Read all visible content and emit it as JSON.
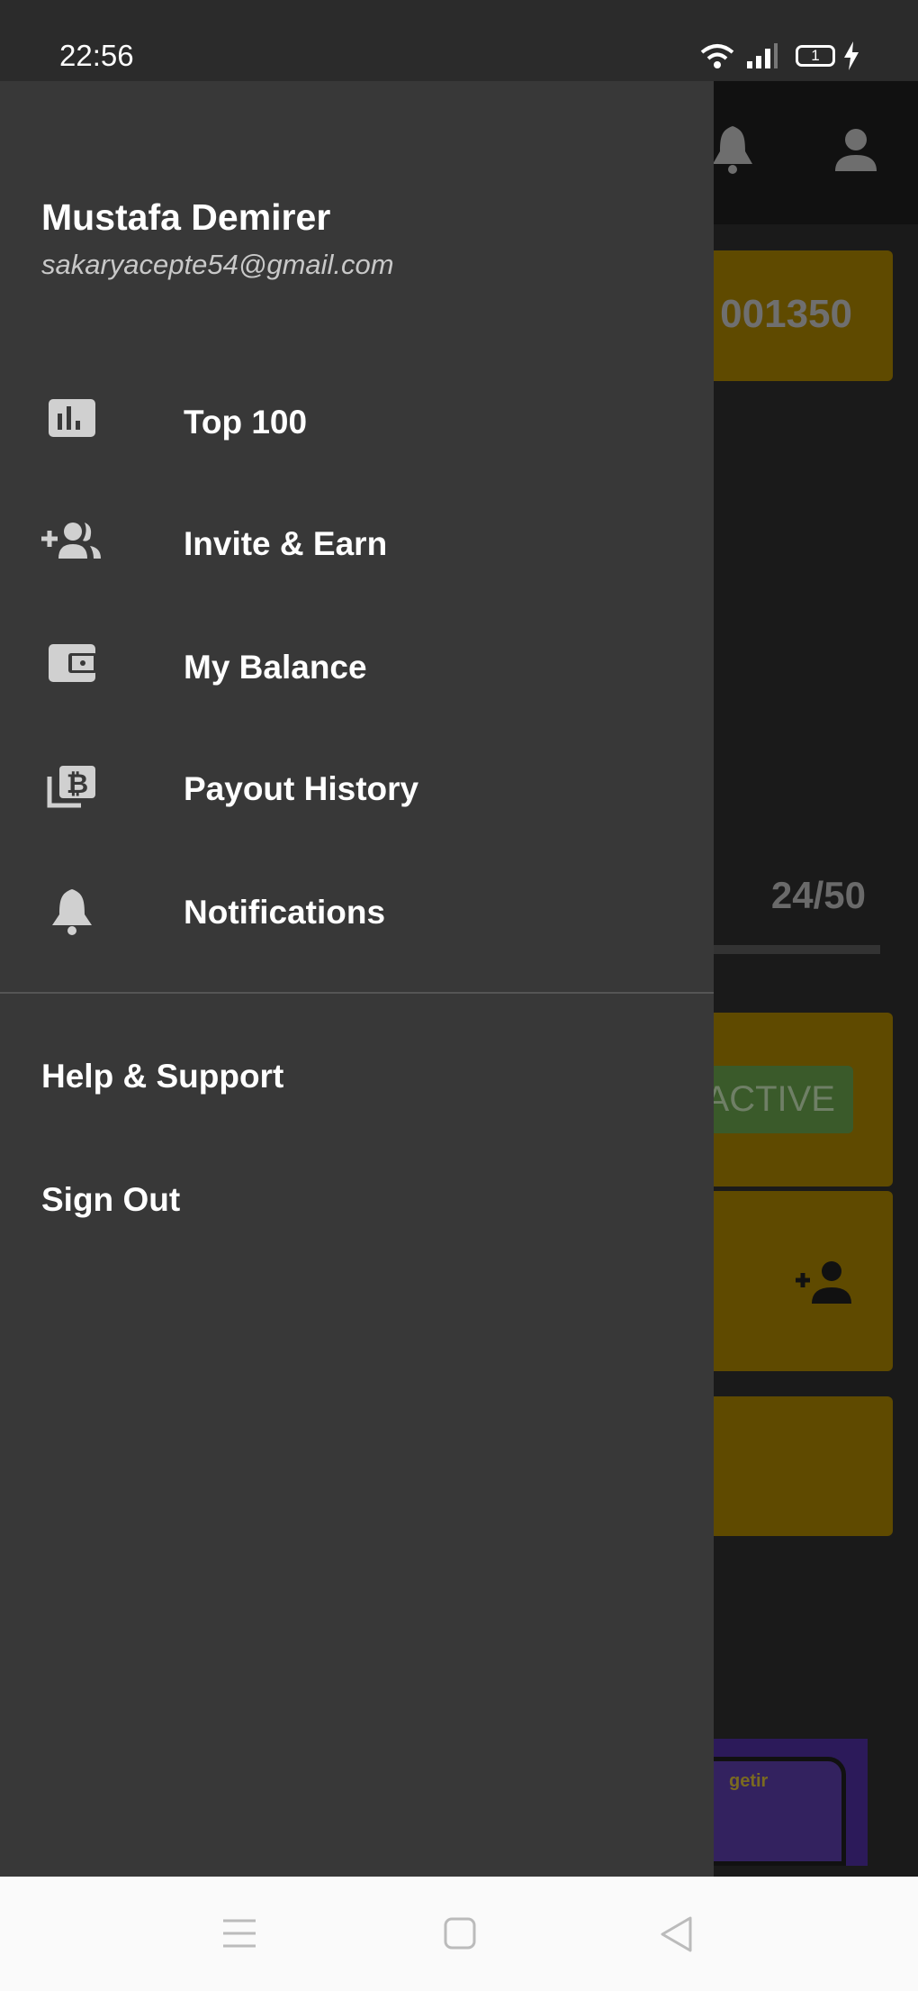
{
  "status_bar": {
    "time": "22:56",
    "battery_label": "1"
  },
  "background": {
    "code_value": "001350",
    "progress_text": "24/50",
    "progress_fraction": 0.48,
    "status_badge": "ACTIVE",
    "ad_brand": "getir",
    "colors": {
      "card": "#5f4a00",
      "badge": "#3a5a2a"
    }
  },
  "drawer": {
    "user_name": "Mustafa Demirer",
    "user_email": "sakaryacepte54@gmail.com",
    "menu": [
      {
        "label": "Top 100",
        "icon": "leaderboard-icon"
      },
      {
        "label": "Invite & Earn",
        "icon": "group-add-icon"
      },
      {
        "label": "My Balance",
        "icon": "wallet-icon"
      },
      {
        "label": "Payout History",
        "icon": "bitcoin-history-icon"
      },
      {
        "label": "Notifications",
        "icon": "bell-icon"
      }
    ],
    "secondary": [
      {
        "label": "Help & Support"
      },
      {
        "label": "Sign Out"
      }
    ],
    "colors": {
      "background": "#383838",
      "icon": "#d0d0d0"
    }
  }
}
